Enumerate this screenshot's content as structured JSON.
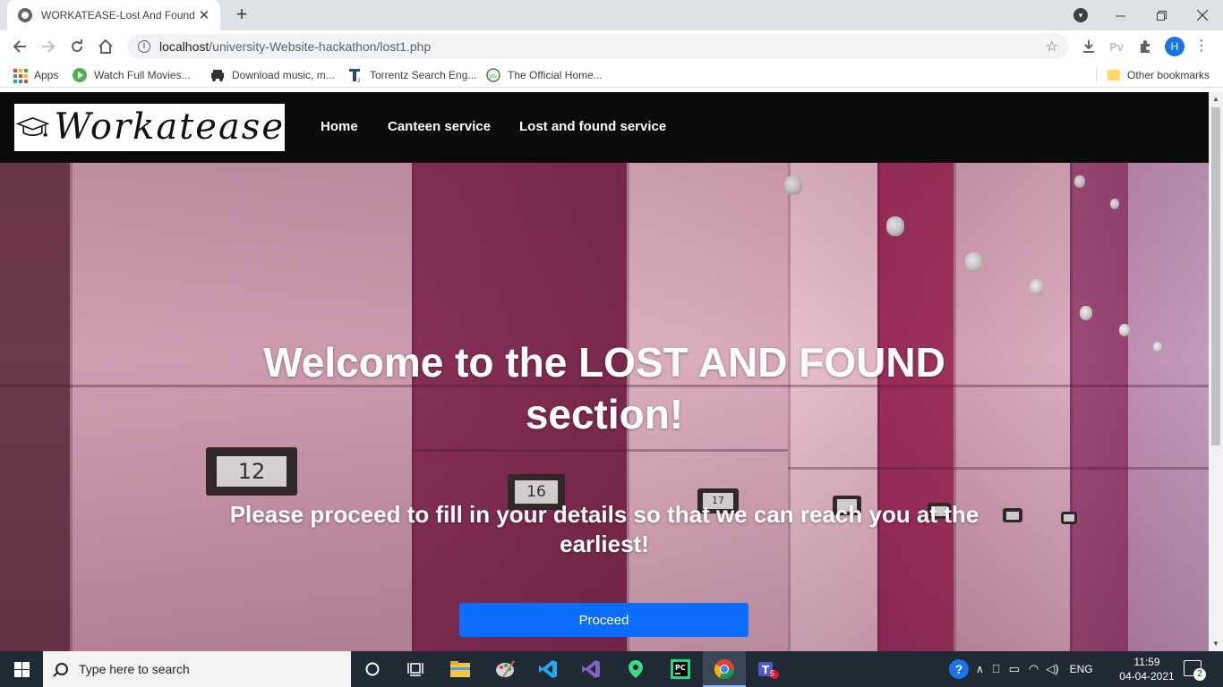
{
  "browser": {
    "tab_title": "WORKATEASE-Lost And Found",
    "tab_close": "✕",
    "new_tab": "+",
    "url_host": "localhost",
    "url_path": "/university-Website-hackathon/lost1.php",
    "avatar_letter": "H",
    "pv_label": "Pv",
    "bookmarks": [
      {
        "label": "Apps",
        "icon": "apps-grid-icon"
      },
      {
        "label": "Watch Full Movies...",
        "icon": "play-icon"
      },
      {
        "label": "Download music, m...",
        "icon": "car-icon"
      },
      {
        "label": "Torrentz Search Eng...",
        "icon": "torrentz-icon"
      },
      {
        "label": "The Official Home...",
        "icon": "yts-icon"
      }
    ],
    "other_bookmarks": "Other bookmarks"
  },
  "site": {
    "logo_text": "Workatease",
    "nav": {
      "home": "Home",
      "canteen": "Canteen service",
      "lost_found": "Lost and found service"
    },
    "hero": {
      "title": "Welcome to the LOST AND FOUND section!",
      "subtitle": "Please proceed to fill in your details so that we can reach you at the earliest!",
      "button": "Proceed",
      "locker_numbers": [
        "12",
        "16",
        "17"
      ]
    },
    "colors": {
      "nav_bg": "#0a0a0a",
      "button_bg": "#0d6efd"
    }
  },
  "taskbar": {
    "search_placeholder": "Type here to search",
    "language": "ENG",
    "time": "11:59",
    "date": "04-04-2021",
    "notification_count": "2",
    "teams_badge": "5"
  }
}
